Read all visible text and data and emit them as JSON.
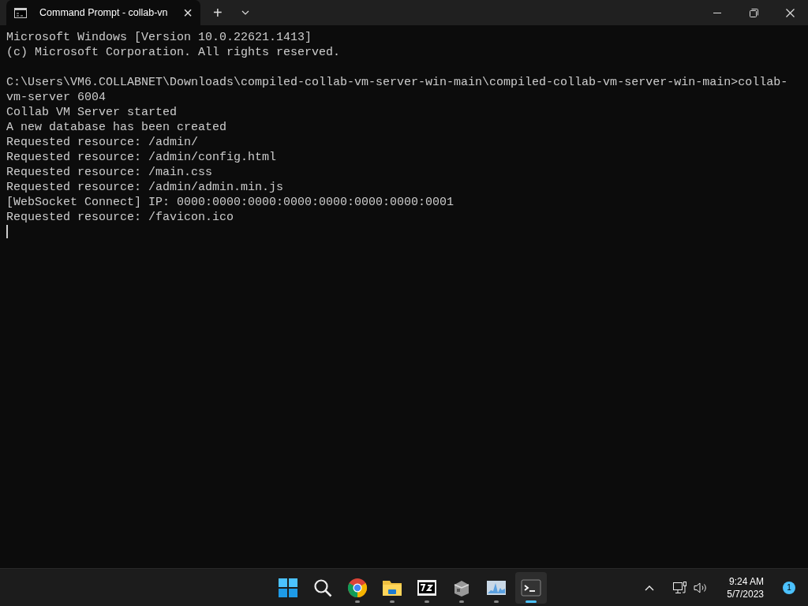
{
  "window": {
    "tab_title": "Command Prompt - collab-vn",
    "tab_close": "×",
    "new_tab": "+"
  },
  "terminal": {
    "blocks": [
      [
        "Microsoft Windows [Version 10.0.22621.1413]",
        "(c) Microsoft Corporation. All rights reserved."
      ],
      [
        "C:\\Users\\VM6.COLLABNET\\Downloads\\compiled-collab-vm-server-win-main\\compiled-collab-vm-server-win-main>collab-",
        "vm-server 6004",
        "Collab VM Server started",
        "A new database has been created",
        "Requested resource: /admin/",
        "Requested resource: /admin/config.html",
        "Requested resource: /main.css",
        "Requested resource: /admin/admin.min.js",
        "[WebSocket Connect] IP: 0000:0000:0000:0000:0000:0000:0000:0001",
        "Requested resource: /favicon.ico"
      ]
    ],
    "cursor": true
  },
  "taskbar": {
    "apps": [
      {
        "kind": "start",
        "running": false,
        "active": false
      },
      {
        "kind": "search",
        "running": false,
        "active": false
      },
      {
        "kind": "chrome",
        "running": true,
        "active": false
      },
      {
        "kind": "folder",
        "running": true,
        "active": false
      },
      {
        "kind": "sevenzip",
        "running": true,
        "active": false
      },
      {
        "kind": "box",
        "running": true,
        "active": false
      },
      {
        "kind": "monitor",
        "running": true,
        "active": false
      },
      {
        "kind": "terminal",
        "running": true,
        "active": true
      }
    ],
    "time": "9:24 AM",
    "date": "5/7/2023",
    "notifications": "1"
  }
}
